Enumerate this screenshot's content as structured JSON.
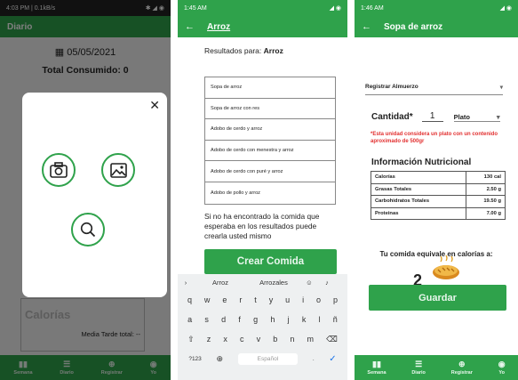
{
  "panel1": {
    "status": {
      "time": "4:03 PM | 0.1kB/s",
      "icons": "✱ ◢ ◉"
    },
    "title": "Diario",
    "date": "05/05/2021",
    "total_label": "Total Consumido: 0",
    "card": {
      "calorias": "Calorías",
      "media": "Media Tarde total: --"
    },
    "nav": [
      {
        "label": "Semana",
        "icon": "chart-icon"
      },
      {
        "label": "Diario",
        "icon": "list-icon"
      },
      {
        "label": "Registrar",
        "icon": "add-icon"
      },
      {
        "label": "Yo",
        "icon": "user-icon"
      }
    ]
  },
  "panel2": {
    "status": {
      "time": "1:45 AM",
      "icons": "◢ ◉"
    },
    "title": "Arroz",
    "results_prefix": "Resultados para: ",
    "results_query": "Arroz",
    "results": [
      "Sopa de arroz",
      "Sopa de arroz con res",
      "Adobo de cerdo y arroz",
      "Adobo de cerdo con menestra y arroz",
      "Adobo de cerdo con puré y arroz",
      "Adobo de pollo y arroz"
    ],
    "not_found": "Si no ha encontrado la comida que esperaba en los resultados puede crearla usted mismo",
    "create_button": "Crear Comida",
    "keyboard": {
      "suggestions": [
        "Arroz",
        "Arrozales"
      ],
      "row1": [
        "q",
        "w",
        "e",
        "r",
        "t",
        "y",
        "u",
        "i",
        "o",
        "p"
      ],
      "row2": [
        "a",
        "s",
        "d",
        "f",
        "g",
        "h",
        "j",
        "k",
        "l",
        "ñ"
      ],
      "row3": [
        "z",
        "x",
        "c",
        "v",
        "b",
        "n",
        "m"
      ],
      "symbols": "?123",
      "space": "Español",
      "period": "."
    }
  },
  "panel3": {
    "status": {
      "time": "1:46 AM",
      "icons": "◢ ◉"
    },
    "title": "Sopa de arroz",
    "meal_select": "Registrar Almuerzo",
    "quantity_label": "Cantidad*",
    "quantity_value": "1",
    "unit_select": "Plato",
    "warning": "*Esta unidad considera un plato con un contenido aproximado de 500gr",
    "info_title": "Información Nutricional",
    "nutrition": [
      {
        "name": "Calorías",
        "value": "130 cal"
      },
      {
        "name": "Grasas Totales",
        "value": "2.50 g"
      },
      {
        "name": "Carbohidratos Totales",
        "value": "19.50 g"
      },
      {
        "name": "Proteinas",
        "value": "7.00 g"
      }
    ],
    "equiv_text": "Tu comida equivale en calorías a:",
    "equiv_number": "2",
    "save_button": "Guardar",
    "nav": [
      {
        "label": "Semana",
        "icon": "chart-icon"
      },
      {
        "label": "Diario",
        "icon": "list-icon"
      },
      {
        "label": "Registrar",
        "icon": "add-icon"
      },
      {
        "label": "Yo",
        "icon": "user-icon"
      }
    ]
  },
  "colors": {
    "primary": "#2fa24b",
    "warning": "#e23030"
  }
}
